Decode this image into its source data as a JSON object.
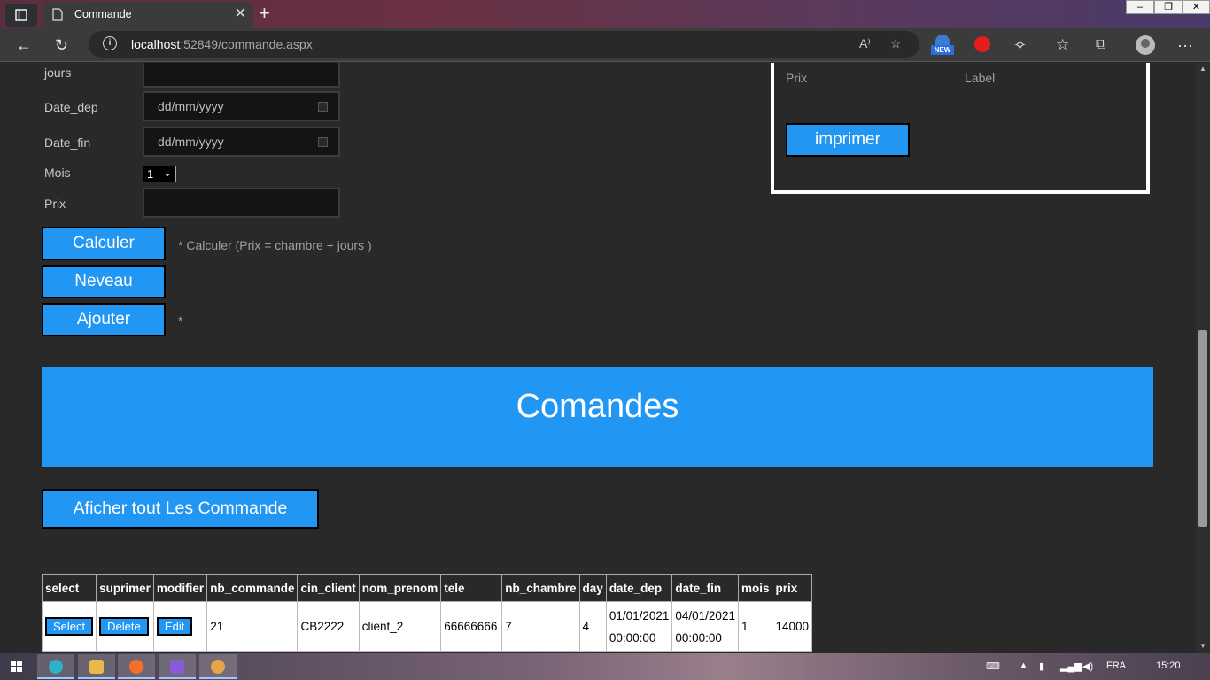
{
  "browser": {
    "tab_title": "Commande",
    "url_host": "localhost",
    "url_path": ":52849/commande.aspx",
    "new_badge": "NEW"
  },
  "form": {
    "jours_label": "jours",
    "date_dep_label": "Date_dep",
    "date_dep_placeholder": "dd/mm/yyyy",
    "date_fin_label": "Date_fin",
    "date_fin_placeholder": "dd/mm/yyyy",
    "mois_label": "Mois",
    "mois_value": "1",
    "prix_label": "Prix",
    "calculer_label": "Calculer",
    "calculer_note": "* Calculer (Prix = chambre + jours )",
    "neveau_label": "Neveau",
    "ajouter_label": "Ajouter",
    "ajouter_note": "*"
  },
  "print_panel": {
    "prix_label": "Prix",
    "label_label": "Label",
    "imprimer_label": "imprimer"
  },
  "banner": {
    "title": "Comandes"
  },
  "show_all_label": "Aficher tout Les Commande",
  "grid": {
    "headers": [
      "select",
      "suprimer",
      "modifier",
      "nb_commande",
      "cin_client",
      "nom_prenom",
      "tele",
      "nb_chambre",
      "day",
      "date_dep",
      "date_fin",
      "mois",
      "prix"
    ],
    "row": {
      "select": "Select",
      "delete": "Delete",
      "edit": "Edit",
      "nb_commande": "21",
      "cin_client": "CB2222",
      "nom_prenom": "client_2",
      "tele": "66666666",
      "nb_chambre": "7",
      "day": "4",
      "date_dep_date": "01/01/2021",
      "date_dep_time": "00:00:00",
      "date_fin_date": "04/01/2021",
      "date_fin_time": "00:00:00",
      "mois": "1",
      "prix": "14000"
    }
  },
  "taskbar": {
    "language": "FRA",
    "clock": "15:20"
  },
  "colors": {
    "accent": "#2196f3",
    "page_bg": "#292929",
    "input_bg": "#141414"
  }
}
